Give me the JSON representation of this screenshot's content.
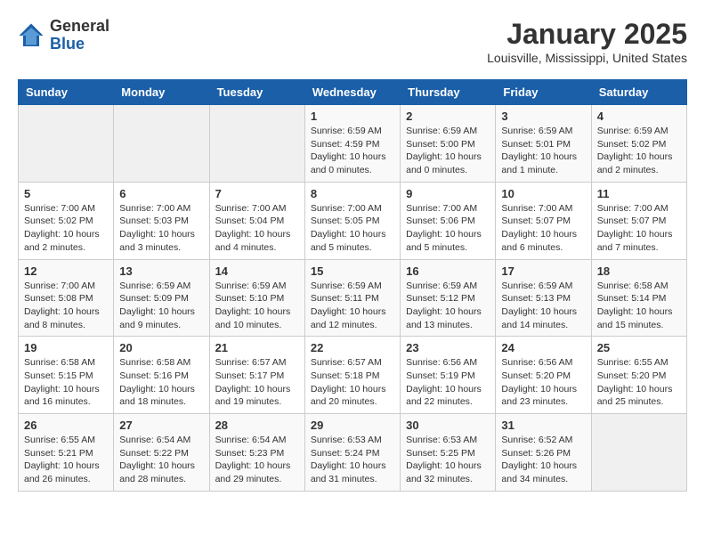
{
  "header": {
    "logo_general": "General",
    "logo_blue": "Blue",
    "month_title": "January 2025",
    "location": "Louisville, Mississippi, United States"
  },
  "days_of_week": [
    "Sunday",
    "Monday",
    "Tuesday",
    "Wednesday",
    "Thursday",
    "Friday",
    "Saturday"
  ],
  "weeks": [
    [
      {
        "day": "",
        "info": ""
      },
      {
        "day": "",
        "info": ""
      },
      {
        "day": "",
        "info": ""
      },
      {
        "day": "1",
        "info": "Sunrise: 6:59 AM\nSunset: 4:59 PM\nDaylight: 10 hours and 0 minutes."
      },
      {
        "day": "2",
        "info": "Sunrise: 6:59 AM\nSunset: 5:00 PM\nDaylight: 10 hours and 0 minutes."
      },
      {
        "day": "3",
        "info": "Sunrise: 6:59 AM\nSunset: 5:01 PM\nDaylight: 10 hours and 1 minute."
      },
      {
        "day": "4",
        "info": "Sunrise: 6:59 AM\nSunset: 5:02 PM\nDaylight: 10 hours and 2 minutes."
      }
    ],
    [
      {
        "day": "5",
        "info": "Sunrise: 7:00 AM\nSunset: 5:02 PM\nDaylight: 10 hours and 2 minutes."
      },
      {
        "day": "6",
        "info": "Sunrise: 7:00 AM\nSunset: 5:03 PM\nDaylight: 10 hours and 3 minutes."
      },
      {
        "day": "7",
        "info": "Sunrise: 7:00 AM\nSunset: 5:04 PM\nDaylight: 10 hours and 4 minutes."
      },
      {
        "day": "8",
        "info": "Sunrise: 7:00 AM\nSunset: 5:05 PM\nDaylight: 10 hours and 5 minutes."
      },
      {
        "day": "9",
        "info": "Sunrise: 7:00 AM\nSunset: 5:06 PM\nDaylight: 10 hours and 5 minutes."
      },
      {
        "day": "10",
        "info": "Sunrise: 7:00 AM\nSunset: 5:07 PM\nDaylight: 10 hours and 6 minutes."
      },
      {
        "day": "11",
        "info": "Sunrise: 7:00 AM\nSunset: 5:07 PM\nDaylight: 10 hours and 7 minutes."
      }
    ],
    [
      {
        "day": "12",
        "info": "Sunrise: 7:00 AM\nSunset: 5:08 PM\nDaylight: 10 hours and 8 minutes."
      },
      {
        "day": "13",
        "info": "Sunrise: 6:59 AM\nSunset: 5:09 PM\nDaylight: 10 hours and 9 minutes."
      },
      {
        "day": "14",
        "info": "Sunrise: 6:59 AM\nSunset: 5:10 PM\nDaylight: 10 hours and 10 minutes."
      },
      {
        "day": "15",
        "info": "Sunrise: 6:59 AM\nSunset: 5:11 PM\nDaylight: 10 hours and 12 minutes."
      },
      {
        "day": "16",
        "info": "Sunrise: 6:59 AM\nSunset: 5:12 PM\nDaylight: 10 hours and 13 minutes."
      },
      {
        "day": "17",
        "info": "Sunrise: 6:59 AM\nSunset: 5:13 PM\nDaylight: 10 hours and 14 minutes."
      },
      {
        "day": "18",
        "info": "Sunrise: 6:58 AM\nSunset: 5:14 PM\nDaylight: 10 hours and 15 minutes."
      }
    ],
    [
      {
        "day": "19",
        "info": "Sunrise: 6:58 AM\nSunset: 5:15 PM\nDaylight: 10 hours and 16 minutes."
      },
      {
        "day": "20",
        "info": "Sunrise: 6:58 AM\nSunset: 5:16 PM\nDaylight: 10 hours and 18 minutes."
      },
      {
        "day": "21",
        "info": "Sunrise: 6:57 AM\nSunset: 5:17 PM\nDaylight: 10 hours and 19 minutes."
      },
      {
        "day": "22",
        "info": "Sunrise: 6:57 AM\nSunset: 5:18 PM\nDaylight: 10 hours and 20 minutes."
      },
      {
        "day": "23",
        "info": "Sunrise: 6:56 AM\nSunset: 5:19 PM\nDaylight: 10 hours and 22 minutes."
      },
      {
        "day": "24",
        "info": "Sunrise: 6:56 AM\nSunset: 5:20 PM\nDaylight: 10 hours and 23 minutes."
      },
      {
        "day": "25",
        "info": "Sunrise: 6:55 AM\nSunset: 5:20 PM\nDaylight: 10 hours and 25 minutes."
      }
    ],
    [
      {
        "day": "26",
        "info": "Sunrise: 6:55 AM\nSunset: 5:21 PM\nDaylight: 10 hours and 26 minutes."
      },
      {
        "day": "27",
        "info": "Sunrise: 6:54 AM\nSunset: 5:22 PM\nDaylight: 10 hours and 28 minutes."
      },
      {
        "day": "28",
        "info": "Sunrise: 6:54 AM\nSunset: 5:23 PM\nDaylight: 10 hours and 29 minutes."
      },
      {
        "day": "29",
        "info": "Sunrise: 6:53 AM\nSunset: 5:24 PM\nDaylight: 10 hours and 31 minutes."
      },
      {
        "day": "30",
        "info": "Sunrise: 6:53 AM\nSunset: 5:25 PM\nDaylight: 10 hours and 32 minutes."
      },
      {
        "day": "31",
        "info": "Sunrise: 6:52 AM\nSunset: 5:26 PM\nDaylight: 10 hours and 34 minutes."
      },
      {
        "day": "",
        "info": ""
      }
    ]
  ]
}
